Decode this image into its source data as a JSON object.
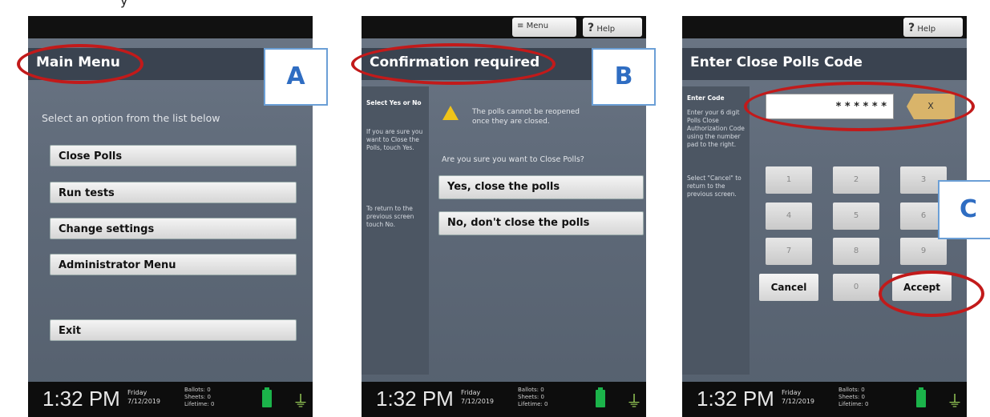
{
  "caption": "y",
  "panel_a": {
    "title": "Main Menu",
    "label": "A",
    "hint": "Select an option from the list below",
    "buttons": [
      "Close Polls",
      "Run tests",
      "Change settings",
      "Administrator Menu",
      "Exit"
    ]
  },
  "panel_b": {
    "title": "Confirmation required",
    "label": "B",
    "menu_label": "Menu",
    "help_label": "Help",
    "side_heading": "Select Yes or No",
    "side_text_1": "If you are sure you want to Close the Polls, touch Yes.",
    "side_text_2": "To return to the previous screen touch No.",
    "warning": "The polls cannot be reopened once they are closed.",
    "question": "Are you sure you want to Close Polls?",
    "yes_label": "Yes, close the polls",
    "no_label": "No, don't close the polls"
  },
  "panel_c": {
    "title": "Enter Close Polls Code",
    "label": "C",
    "help_label": "Help",
    "side_heading": "Enter Code",
    "side_text_1": "Enter your 6 digit Polls Close Authorization Code using the number pad to the right.",
    "side_text_2": "Select \"Cancel\" to return to the previous screen.",
    "code_value": "* * * * * *",
    "clear_label": "X",
    "keys": [
      "1",
      "2",
      "3",
      "4",
      "5",
      "6",
      "7",
      "8",
      "9"
    ],
    "zero": "0",
    "cancel_label": "Cancel",
    "accept_label": "Accept"
  },
  "footer": {
    "time": "1:32 PM",
    "day": "Friday",
    "date": "7/12/2019",
    "ballots": "Ballots:  0",
    "sheets": "Sheets:  0",
    "lifetime": "Lifetime:  0"
  },
  "colors": {
    "highlight": "#c21a1a",
    "label_blue": "#2f6dc2",
    "battery": "#1bb34a"
  }
}
